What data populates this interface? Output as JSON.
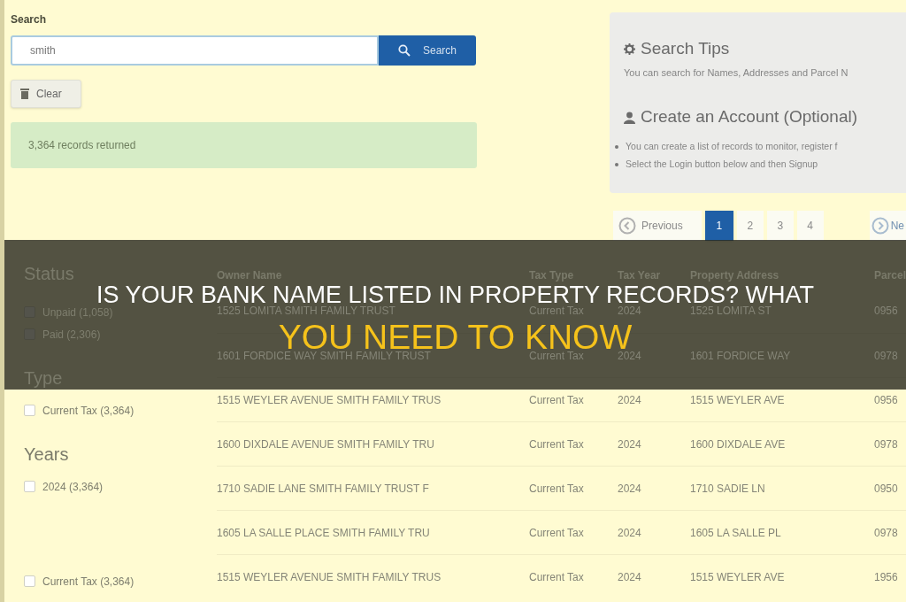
{
  "search": {
    "label": "Search",
    "value": "smith",
    "button": "Search"
  },
  "clear_button": "Clear",
  "result_message": "3,364 records returned",
  "tips_panel": {
    "search_tips": {
      "title": "Search Tips",
      "text": "You can search for Names, Addresses and Parcel N"
    },
    "account": {
      "title": "Create an Account (Optional)",
      "items": [
        "You can create a list of records to monitor, register f",
        "Select the Login button below and then Signup"
      ]
    }
  },
  "pagination": {
    "previous": "Previous",
    "pages": [
      {
        "label": "1",
        "selected": true
      },
      {
        "label": "2",
        "selected": false
      },
      {
        "label": "3",
        "selected": false
      },
      {
        "label": "4",
        "selected": false
      }
    ],
    "next": "Ne"
  },
  "filters": [
    {
      "heading": "Status",
      "options": [
        {
          "label": "Unpaid (1,058)",
          "checked": false
        },
        {
          "label": "Paid (2,306)",
          "checked": false
        }
      ]
    },
    {
      "heading": "Type",
      "options": [
        {
          "label": "Current Tax (3,364)",
          "checked": false
        }
      ]
    },
    {
      "heading": "Years",
      "options": [
        {
          "label": "2024 (3,364)",
          "checked": false
        }
      ]
    },
    {
      "options": [
        {
          "label": "Current Tax (3,364)",
          "checked": false
        }
      ]
    }
  ],
  "table": {
    "columns": [
      "Owner Name",
      "Tax Type",
      "Tax Year",
      "Property Address",
      "Parcel"
    ],
    "rows": [
      [
        "1525 LOMITA SMITH FAMILY TRUST",
        "Current Tax",
        "2024",
        "1525 LOMITA ST",
        "0956"
      ],
      [
        "1601 FORDICE WAY SMITH FAMILY TRUST",
        "Current Tax",
        "2024",
        "1601 FORDICE WAY",
        "0978"
      ],
      [
        "1515 WEYLER AVENUE SMITH FAMILY TRUS",
        "Current Tax",
        "2024",
        "1515 WEYLER AVE",
        "0956"
      ],
      [
        "1600 DIXDALE AVENUE SMITH FAMILY TRU",
        "Current Tax",
        "2024",
        "1600 DIXDALE AVE",
        "0978"
      ],
      [
        "1710 SADIE LANE SMITH FAMILY TRUST F",
        "Current Tax",
        "2024",
        "1710 SADIE LN",
        "0950"
      ],
      [
        "1605 LA SALLE PLACE SMITH FAMILY TRU",
        "Current Tax",
        "2024",
        "1605 LA SALLE PL",
        "0978"
      ],
      [
        "1515 WEYLER AVENUE SMITH FAMILY TRUS",
        "Current Tax",
        "2024",
        "1515 WEYLER AVE",
        "1956"
      ]
    ]
  },
  "banner": {
    "line_1": "IS YOUR BANK NAME LISTED IN PROPERTY RECORDS? WHAT",
    "line_2": "YOU NEED TO KNOW"
  }
}
